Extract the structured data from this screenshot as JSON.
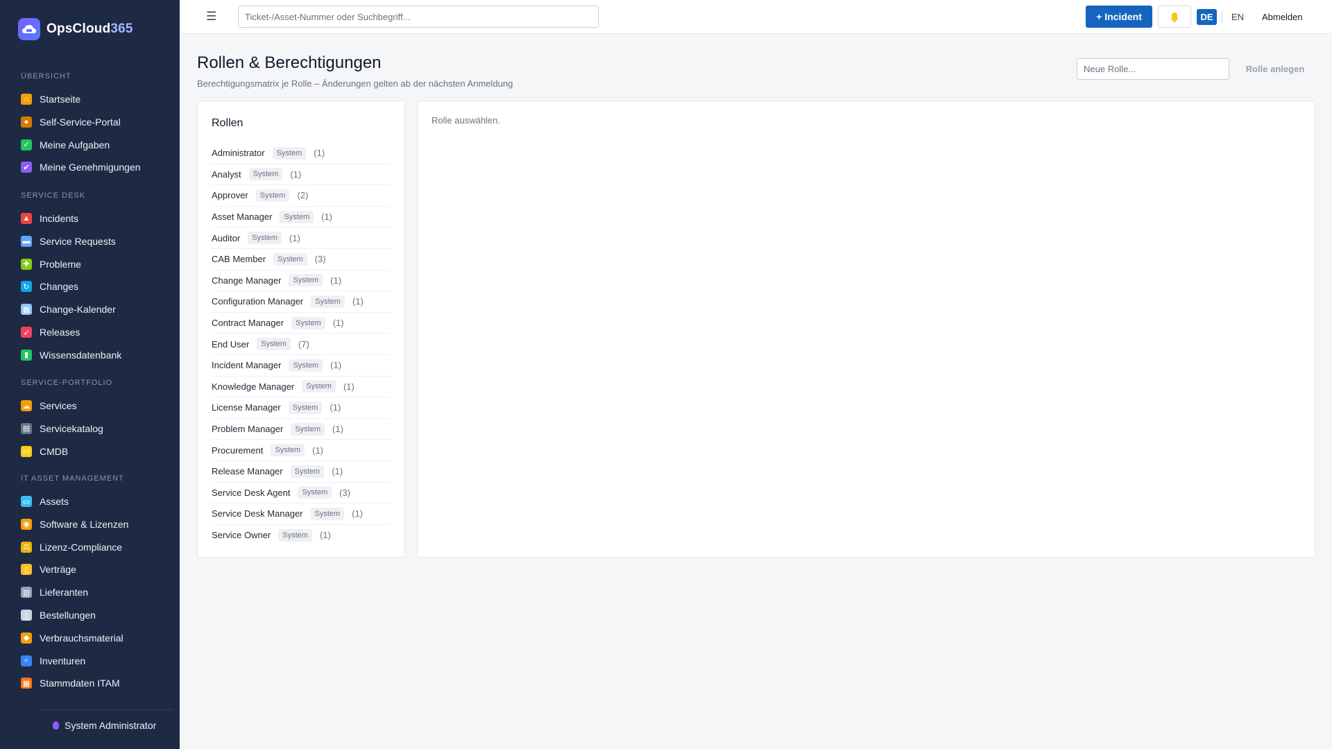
{
  "brand": {
    "name_main": "OpsCloud",
    "name_accent": "365"
  },
  "sidebar": {
    "sections": [
      {
        "label": "ÜBERSICHT",
        "items": [
          {
            "label": "Startseite",
            "icon": "home-icon",
            "color": "#f59e0b"
          },
          {
            "label": "Self-Service-Portal",
            "icon": "person-icon",
            "color": "#d97706"
          },
          {
            "label": "Meine Aufgaben",
            "icon": "checkbox-icon",
            "color": "#22c55e"
          },
          {
            "label": "Meine Genehmigungen",
            "icon": "checkmark-icon",
            "color": "#8b5cf6"
          }
        ]
      },
      {
        "label": "SERVICE DESK",
        "items": [
          {
            "label": "Incidents",
            "icon": "siren-icon",
            "color": "#ef4444"
          },
          {
            "label": "Service Requests",
            "icon": "inbox-icon",
            "color": "#60a5fa"
          },
          {
            "label": "Probleme",
            "icon": "puzzle-icon",
            "color": "#84cc16"
          },
          {
            "label": "Changes",
            "icon": "refresh-icon",
            "color": "#0ea5e9"
          },
          {
            "label": "Change-Kalender",
            "icon": "calendar-icon",
            "color": "#93c5fd"
          },
          {
            "label": "Releases",
            "icon": "rocket-icon",
            "color": "#f43f5e"
          },
          {
            "label": "Wissensdatenbank",
            "icon": "books-icon",
            "color": "#22c55e"
          }
        ]
      },
      {
        "label": "SERVICE-PORTFOLIO",
        "items": [
          {
            "label": "Services",
            "icon": "cloud-icon",
            "color": "#f59e0b"
          },
          {
            "label": "Servicekatalog",
            "icon": "catalog-icon",
            "color": "#64748b"
          },
          {
            "label": "CMDB",
            "icon": "folder-icon",
            "color": "#facc15"
          }
        ]
      },
      {
        "label": "IT ASSET MANAGEMENT",
        "items": [
          {
            "label": "Assets",
            "icon": "laptop-icon",
            "color": "#38bdf8"
          },
          {
            "label": "Software & Lizenzen",
            "icon": "disc-icon",
            "color": "#f59e0b"
          },
          {
            "label": "Lizenz-Compliance",
            "icon": "scales-icon",
            "color": "#eab308"
          },
          {
            "label": "Verträge",
            "icon": "scroll-icon",
            "color": "#fbbf24"
          },
          {
            "label": "Lieferanten",
            "icon": "building-icon",
            "color": "#94a3b8"
          },
          {
            "label": "Bestellungen",
            "icon": "receipt-icon",
            "color": "#cbd5e1"
          },
          {
            "label": "Verbrauchsmaterial",
            "icon": "box-icon",
            "color": "#f59e0b"
          },
          {
            "label": "Inventuren",
            "icon": "magnifier-icon",
            "color": "#3b82f6"
          },
          {
            "label": "Stammdaten ITAM",
            "icon": "bricks-icon",
            "color": "#f97316"
          }
        ]
      }
    ],
    "user": "System Administrator"
  },
  "topbar": {
    "search_placeholder": "Ticket-/Asset-Nummer oder Suchbegriff...",
    "incident_button": "+ Incident",
    "lang_de": "DE",
    "lang_en": "EN",
    "logout": "Abmelden"
  },
  "page": {
    "title": "Rollen & Berechtigungen",
    "subtitle": "Berechtigungsmatrix je Rolle – Änderungen gelten ab der nächsten Anmeldung",
    "new_role_placeholder": "Neue Rolle...",
    "create_button": "Rolle anlegen"
  },
  "roles_card": {
    "title": "Rollen",
    "badge": "System",
    "roles": [
      {
        "name": "Administrator",
        "count": "(1)"
      },
      {
        "name": "Analyst",
        "count": "(1)"
      },
      {
        "name": "Approver",
        "count": "(2)"
      },
      {
        "name": "Asset Manager",
        "count": "(1)"
      },
      {
        "name": "Auditor",
        "count": "(1)"
      },
      {
        "name": "CAB Member",
        "count": "(3)"
      },
      {
        "name": "Change Manager",
        "count": "(1)"
      },
      {
        "name": "Configuration Manager",
        "count": "(1)"
      },
      {
        "name": "Contract Manager",
        "count": "(1)"
      },
      {
        "name": "End User",
        "count": "(7)"
      },
      {
        "name": "Incident Manager",
        "count": "(1)"
      },
      {
        "name": "Knowledge Manager",
        "count": "(1)"
      },
      {
        "name": "License Manager",
        "count": "(1)"
      },
      {
        "name": "Problem Manager",
        "count": "(1)"
      },
      {
        "name": "Procurement",
        "count": "(1)"
      },
      {
        "name": "Release Manager",
        "count": "(1)"
      },
      {
        "name": "Service Desk Agent",
        "count": "(3)"
      },
      {
        "name": "Service Desk Manager",
        "count": "(1)"
      },
      {
        "name": "Service Owner",
        "count": "(1)"
      }
    ]
  },
  "detail_card": {
    "empty_text": "Rolle auswählen."
  }
}
